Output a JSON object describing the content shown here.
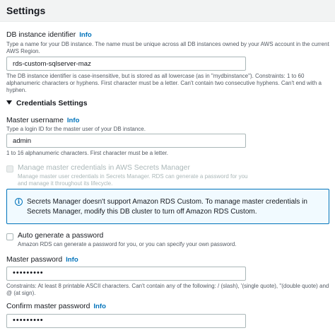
{
  "header": {
    "title": "Settings"
  },
  "db_identifier": {
    "label": "DB instance identifier",
    "info": "Info",
    "description": "Type a name for your DB instance. The name must be unique across all DB instances owned by your AWS account in the current AWS Region.",
    "value": "rds-custom-sqlserver-maz",
    "constraint": "The DB instance identifier is case-insensitive, but is stored as all lowercase (as in \"mydbinstance\"). Constraints: 1 to 60 alphanumeric characters or hyphens. First character must be a letter. Can't contain two consecutive hyphens. Can't end with a hyphen."
  },
  "credentials": {
    "title": "Credentials Settings",
    "master_username": {
      "label": "Master username",
      "info": "Info",
      "description": "Type a login ID for the master user of your DB instance.",
      "value": "admin",
      "constraint": "1 to 16 alphanumeric characters. First character must be a letter."
    },
    "secrets_manager": {
      "label": "Manage master credentials in AWS Secrets Manager",
      "description": "Manage master user credentials in Secrets Manager. RDS can generate a password for you and manage it throughout its lifecycle.",
      "checked": false,
      "disabled": true
    },
    "alert": {
      "text": "Secrets Manager doesn't support Amazon RDS Custom. To manage master credentials in Secrets Manager, modify this DB cluster to turn off Amazon RDS Custom."
    },
    "auto_generate": {
      "label": "Auto generate a password",
      "description": "Amazon RDS can generate a password for you, or you can specify your own password.",
      "checked": false
    },
    "master_password": {
      "label": "Master password",
      "info": "Info",
      "value": "•••••••••",
      "constraint": "Constraints: At least 8 printable ASCII characters. Can't contain any of the following: / (slash), '(single quote), \"(double quote) and @ (at sign)."
    },
    "confirm_password": {
      "label": "Confirm master password",
      "info": "Info",
      "value": "•••••••••"
    }
  }
}
